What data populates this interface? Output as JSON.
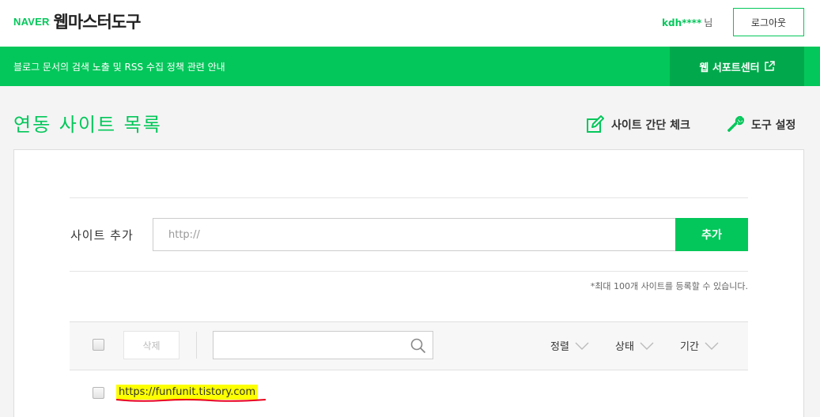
{
  "header": {
    "brand": "NAVER",
    "title": "웹마스터도구",
    "user": "kdh****",
    "user_suffix": "님",
    "logout_label": "로그아웃"
  },
  "banner": {
    "notice": "블로그 문서의 검색 노출 및 RSS 수집 정책 관련 안내",
    "support_label": "웹 서포트센터"
  },
  "page": {
    "title": "연동 사이트 목록",
    "site_check_label": "사이트 간단 체크",
    "tool_settings_label": "도구 설정"
  },
  "add_site": {
    "label": "사이트 추가",
    "placeholder": "http://",
    "button": "추가",
    "limit_note": "*최대 100개 사이트를 등록할 수 있습니다."
  },
  "list_toolbar": {
    "delete_label": "삭제",
    "search_placeholder": "",
    "filters": [
      "정렬",
      "상태",
      "기간"
    ]
  },
  "sites": [
    {
      "url": "https://funfunit.tistory.com",
      "highlighted": true
    }
  ],
  "colors": {
    "brand_green": "#03c75a",
    "support_green": "#02a94c",
    "highlight": "#fbff00",
    "annotation_underline": "#e8001c"
  }
}
